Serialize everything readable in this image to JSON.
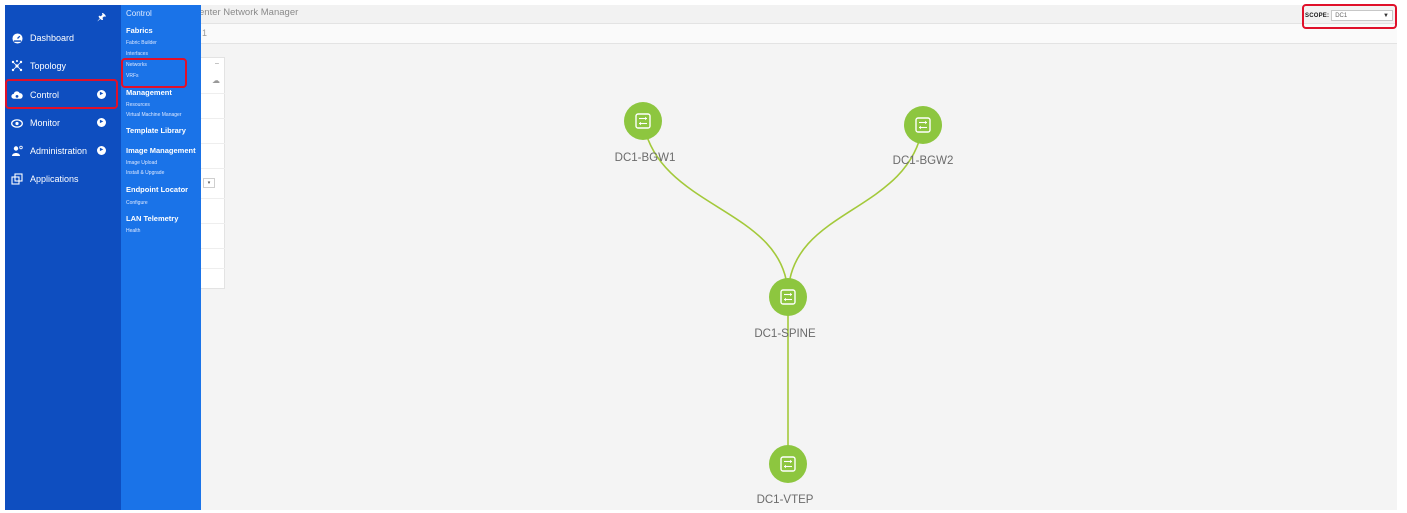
{
  "app": {
    "title": "enter Network Manager",
    "breadcrumb": "1",
    "scope_label": "SCOPE:",
    "scope_value": "DC1",
    "accent": "#82b74b"
  },
  "sidebar": {
    "pin_icon": "pin-icon",
    "items": [
      {
        "label": "Dashboard",
        "icon": "dashboard-icon"
      },
      {
        "label": "Topology",
        "icon": "topology-icon"
      },
      {
        "label": "Control",
        "icon": "cloud-icon",
        "active": true
      },
      {
        "label": "Monitor",
        "icon": "eye-icon"
      },
      {
        "label": "Administration",
        "icon": "admin-user-icon"
      },
      {
        "label": "Applications",
        "icon": "applications-icon"
      }
    ],
    "color": "#0e4ec0"
  },
  "submenu": {
    "title": "Control",
    "sections": [
      {
        "heading": "Fabrics",
        "links": [
          "Fabric Builder",
          "Interfaces",
          "Networks",
          "VRFs"
        ]
      },
      {
        "heading": "Management",
        "links": [
          "Resources",
          "Virtual Machine Manager"
        ]
      },
      {
        "heading": "Template Library",
        "links": []
      },
      {
        "heading": "Image Management",
        "links": [
          "Image Upload",
          "Install & Upgrade"
        ]
      },
      {
        "heading": "Endpoint Locator",
        "links": [
          "Configure"
        ]
      },
      {
        "heading": "LAN Telemetry",
        "links": [
          "Health"
        ]
      }
    ],
    "color": "#1a73e8"
  },
  "topology": {
    "node_color": "#8dc63f",
    "link_color": "#a3c93a",
    "nodes": [
      {
        "id": "DC1-BGW1",
        "label": "DC1-BGW1",
        "icon": "switch-icon"
      },
      {
        "id": "DC1-BGW2",
        "label": "DC1-BGW2",
        "icon": "switch-icon"
      },
      {
        "id": "DC1-SPINE",
        "label": "DC1-SPINE",
        "icon": "switch-icon"
      },
      {
        "id": "DC1-VTEP",
        "label": "DC1-VTEP",
        "icon": "switch-icon"
      }
    ],
    "links": [
      {
        "from": "DC1-BGW1",
        "to": "DC1-SPINE"
      },
      {
        "from": "DC1-BGW2",
        "to": "DC1-SPINE"
      },
      {
        "from": "DC1-SPINE",
        "to": "DC1-VTEP"
      }
    ]
  }
}
